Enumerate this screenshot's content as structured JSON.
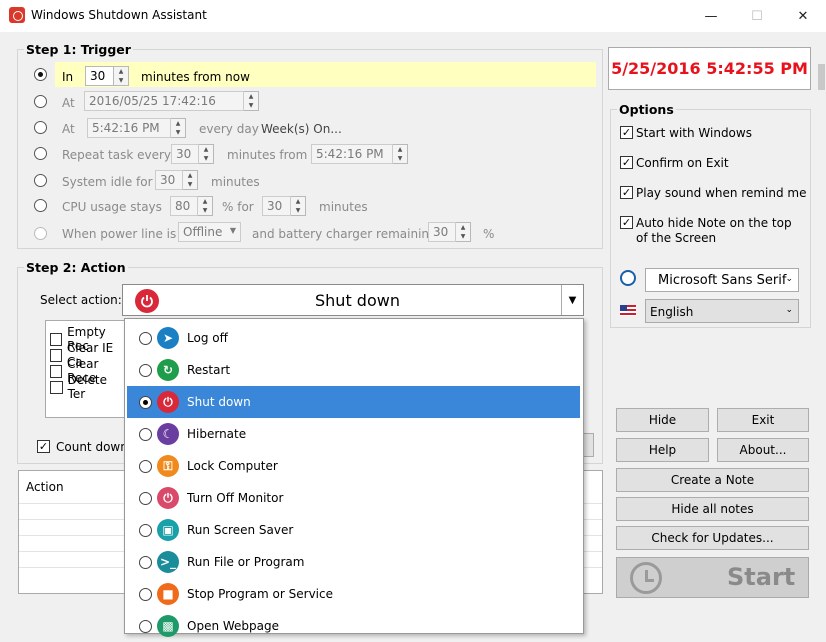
{
  "window": {
    "title": "Windows Shutdown Assistant"
  },
  "clock": "5/25/2016 5:42:55 PM",
  "trigger": {
    "legend": "Step 1: Trigger",
    "in_label": "In",
    "in_value": "30",
    "in_suffix": "minutes from now",
    "at_label": "At",
    "at_value": "2016/05/25   17:42:16",
    "at2_label": "At",
    "at2_value": "5:42:16 PM",
    "every_day": "every day",
    "weeks_on": "Week(s) On...",
    "repeat_label": "Repeat task every",
    "repeat_value": "30",
    "repeat_mid": "minutes from",
    "repeat_time": "5:42:16 PM",
    "idle_label": "System idle for",
    "idle_value": "30",
    "idle_suffix": "minutes",
    "cpu_label": "CPU usage stays",
    "cpu_value": "80",
    "cpu_for": "% for",
    "cpu_minutes": "30",
    "cpu_suffix": "minutes",
    "power_label": "When power line is",
    "power_value": "Offline",
    "power_mid": "and battery charger remaining",
    "power_pct": "30",
    "power_suffix": "%"
  },
  "action": {
    "legend": "Step 2: Action",
    "select_label": "Select action:",
    "selected": "Shut down",
    "checks": [
      "Empty Rec",
      "Clear IE Ca",
      "Clear Rece",
      "Delete Ter"
    ],
    "countdown": "Count down"
  },
  "history": {
    "header": "Action"
  },
  "options": {
    "legend": "Options",
    "items": [
      "Start with Windows",
      "Confirm on Exit",
      "Play sound when remind me",
      "Auto hide Note on the top of the Screen"
    ],
    "font": "Microsoft Sans Serif",
    "language": "English"
  },
  "buttons": {
    "hide": "Hide",
    "exit": "Exit",
    "help": "Help",
    "about": "About...",
    "create_note": "Create a Note",
    "hide_notes": "Hide all notes",
    "updates": "Check for Updates...",
    "start": "Start"
  },
  "menu": [
    {
      "label": "Log off",
      "icon": "log-off-icon",
      "color": "#1b7fc4"
    },
    {
      "label": "Restart",
      "icon": "restart-icon",
      "color": "#1e9e4a"
    },
    {
      "label": "Shut down",
      "icon": "power-icon",
      "color": "#d9283a"
    },
    {
      "label": "Hibernate",
      "icon": "moon-icon",
      "color": "#6a3ea1"
    },
    {
      "label": "Lock Computer",
      "icon": "lock-icon",
      "color": "#f08a1c"
    },
    {
      "label": "Turn Off Monitor",
      "icon": "monitor-icon",
      "color": "#d94a6a"
    },
    {
      "label": "Run Screen Saver",
      "icon": "image-icon",
      "color": "#1aa0a8"
    },
    {
      "label": "Run File or Program",
      "icon": "terminal-icon",
      "color": "#1a8c9a"
    },
    {
      "label": "Stop Program or Service",
      "icon": "stop-icon",
      "color": "#f06a1c"
    },
    {
      "label": "Open Webpage",
      "icon": "web-icon",
      "color": "#1e9a6a"
    }
  ],
  "colors": {
    "clock": "#e8121c",
    "highlight_row": "#ffffc0",
    "selected": "#3a86d8"
  }
}
